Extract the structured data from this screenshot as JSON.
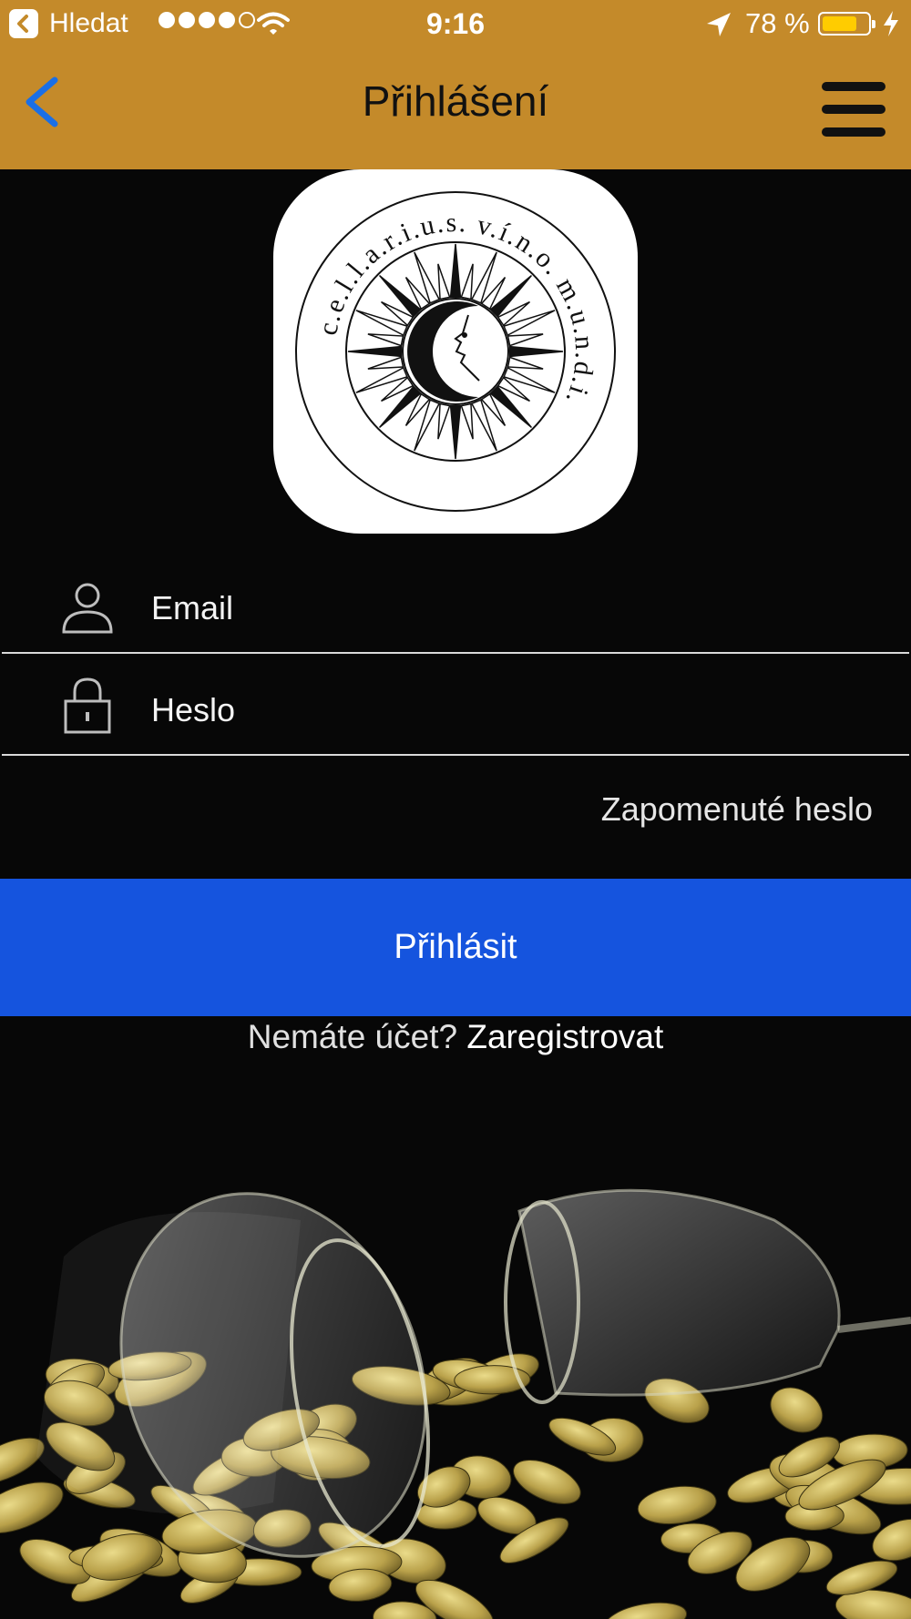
{
  "status_bar": {
    "back_app_label": "Hledat",
    "time": "9:16",
    "battery_percent": "78 %",
    "battery_level": 0.78,
    "signal_bars_filled": 4,
    "signal_bars_total": 5,
    "battery_color": "#ffcc00"
  },
  "nav": {
    "title": "Přihlášení",
    "back_icon": "chevron-left-icon",
    "menu_icon": "hamburger-menu-icon",
    "bar_color": "#c48a2a",
    "back_color": "#1a6fe6"
  },
  "logo": {
    "ring_text": "c.e.l.l.a.r.i.u.s. v.í.n.o. m.u.n.d.i.",
    "icon": "sun-moon-logo"
  },
  "form": {
    "email": {
      "placeholder": "Email",
      "value": "",
      "icon": "user-icon"
    },
    "password": {
      "placeholder": "Heslo",
      "value": "",
      "icon": "lock-icon"
    },
    "forgot_password": "Zapomenuté heslo",
    "login_button": "Přihlásit",
    "login_color": "#1554de"
  },
  "register": {
    "question": "Nemáte účet?",
    "link": "Zaregistrovat"
  },
  "background": {
    "image": "wine-glasses-and-corks-photo"
  }
}
